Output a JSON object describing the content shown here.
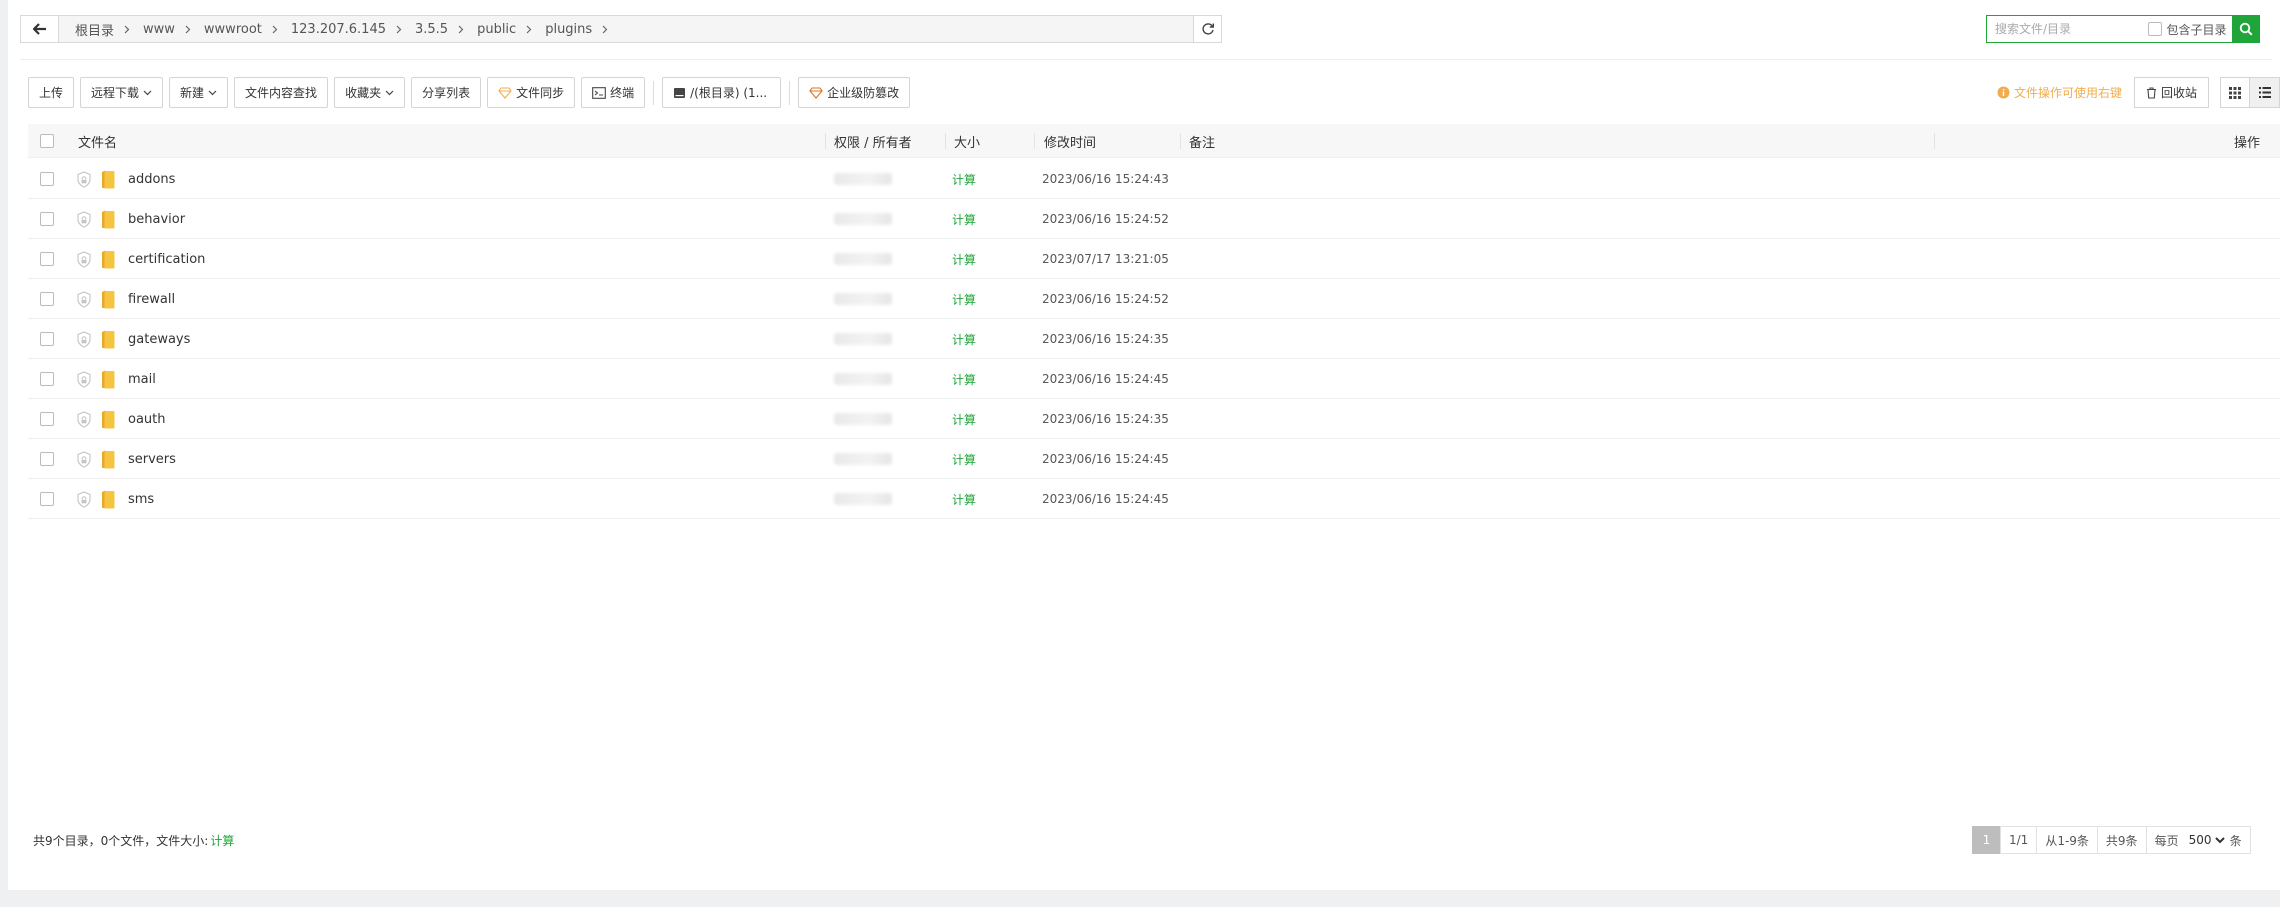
{
  "path": {
    "crumbs": [
      "根目录",
      "www",
      "wwwroot",
      "123.207.6.145",
      "3.5.5",
      "public",
      "plugins"
    ]
  },
  "search": {
    "placeholder": "搜索文件/目录",
    "include_subdir_label": "包含子目录"
  },
  "toolbar": {
    "upload": "上传",
    "remote_download": "远程下载",
    "new": "新建",
    "content_search": "文件内容查找",
    "favorites": "收藏夹",
    "share_list": "分享列表",
    "file_sync": "文件同步",
    "terminal": "终端",
    "disk": "/(根目录) (1...",
    "tamper_proof": "企业级防篡改",
    "tip": "文件操作可使用右键",
    "recycle_bin": "回收站"
  },
  "table": {
    "headers": {
      "name": "文件名",
      "permission": "权限 / 所有者",
      "size": "大小",
      "mtime": "修改时间",
      "note": "备注",
      "actions": "操作"
    },
    "rows": [
      {
        "name": "addons",
        "size": "计算",
        "mtime": "2023/06/16 15:24:43"
      },
      {
        "name": "behavior",
        "size": "计算",
        "mtime": "2023/06/16 15:24:52"
      },
      {
        "name": "certification",
        "size": "计算",
        "mtime": "2023/07/17 13:21:05"
      },
      {
        "name": "firewall",
        "size": "计算",
        "mtime": "2023/06/16 15:24:52"
      },
      {
        "name": "gateways",
        "size": "计算",
        "mtime": "2023/06/16 15:24:35"
      },
      {
        "name": "mail",
        "size": "计算",
        "mtime": "2023/06/16 15:24:45"
      },
      {
        "name": "oauth",
        "size": "计算",
        "mtime": "2023/06/16 15:24:35"
      },
      {
        "name": "servers",
        "size": "计算",
        "mtime": "2023/06/16 15:24:45"
      },
      {
        "name": "sms",
        "size": "计算",
        "mtime": "2023/06/16 15:24:45"
      }
    ]
  },
  "footer": {
    "summary": "共9个目录，0个文件，文件大小:",
    "calc": "计算",
    "page_current": "1",
    "page_total": "1/1",
    "range": "从1-9条",
    "total": "共9条",
    "per_page_label": "每页",
    "per_page_value": "500",
    "per_page_unit": "条"
  },
  "colors": {
    "accent": "#20a53a",
    "folder": "#f5c440",
    "tip": "#f0ad4e"
  }
}
